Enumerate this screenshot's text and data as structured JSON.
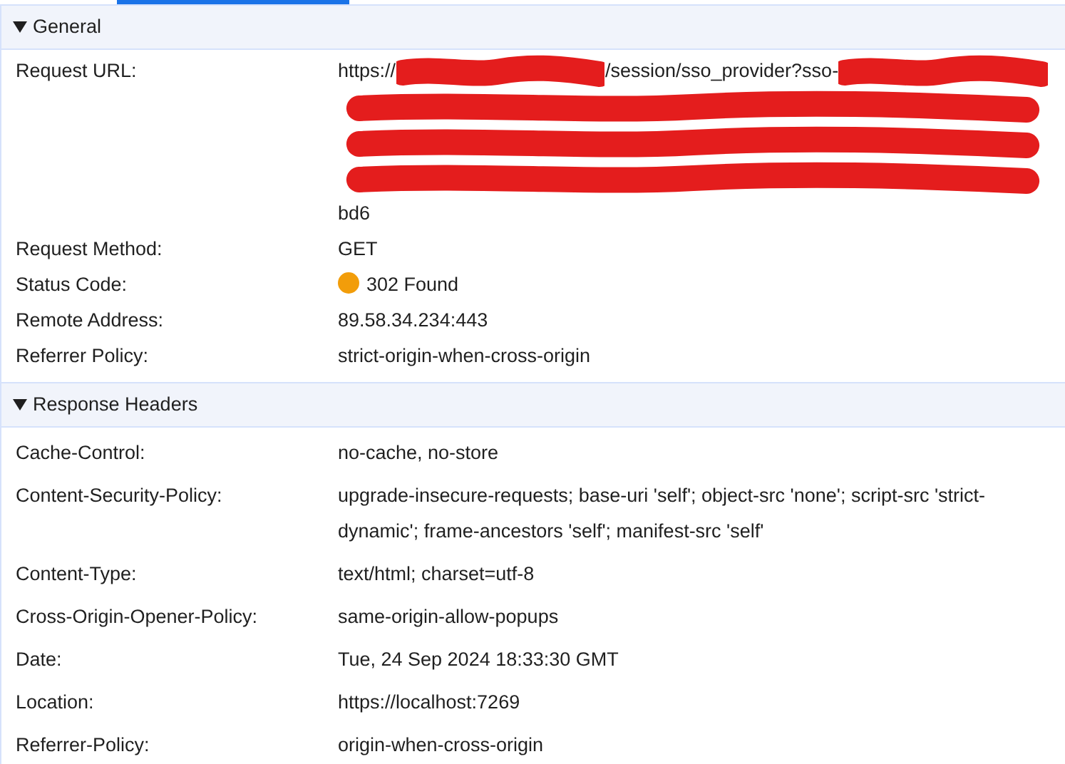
{
  "tabs_indicator": {
    "selected": true
  },
  "sections": [
    {
      "title": "General",
      "expanded": true,
      "rows": [
        {
          "name": "Request URL:",
          "lines": [
            [
              {
                "kind": "text",
                "text": "https://"
              },
              {
                "kind": "redaction"
              },
              {
                "kind": "text",
                "text": "/session/sso_provider?sso-"
              },
              {
                "kind": "redaction"
              }
            ],
            [
              {
                "kind": "redaction"
              }
            ],
            [
              {
                "kind": "redaction"
              }
            ],
            [
              {
                "kind": "redaction"
              }
            ],
            [
              {
                "kind": "text",
                "text": "bd6"
              }
            ]
          ]
        },
        {
          "name": "Request Method:",
          "value": "GET"
        },
        {
          "name": "Status Code:",
          "value": "302 Found",
          "color": "#f29d0a"
        },
        {
          "name": "Remote Address:",
          "value": "89.58.34.234:443"
        },
        {
          "name": "Referrer Policy:",
          "value": "strict-origin-when-cross-origin"
        }
      ]
    },
    {
      "title": "Response Headers",
      "expanded": true,
      "rows": [
        {
          "name": "Cache-Control:",
          "value": "no-cache, no-store"
        },
        {
          "name": "Content-Security-Policy:",
          "value": "upgrade-insecure-requests; base-uri 'self'; object-src 'none'; script-src 'strict-dynamic'; frame-ancestors 'self'; manifest-src 'self'"
        },
        {
          "name": "Content-Type:",
          "value": "text/html; charset=utf-8"
        },
        {
          "name": "Cross-Origin-Opener-Policy:",
          "value": "same-origin-allow-popups"
        },
        {
          "name": "Date:",
          "value": "Tue, 24 Sep 2024 18:33:30 GMT"
        },
        {
          "name": "Location:",
          "value": "https://localhost:7269"
        },
        {
          "name": "Referrer-Policy:",
          "value": "origin-when-cross-origin"
        }
      ]
    }
  ]
}
